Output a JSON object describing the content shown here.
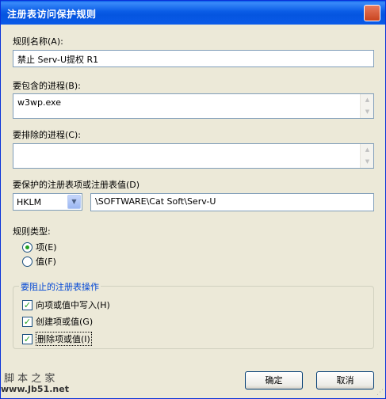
{
  "window": {
    "title": "注册表访问保护规则",
    "close_glyph": "✕"
  },
  "form": {
    "rule_name_label": "规则名称(A):",
    "rule_name_value": "禁止 Serv-U提权 R1",
    "include_label": "要包含的进程(B):",
    "include_value": "w3wp.exe",
    "exclude_label": "要排除的进程(C):",
    "exclude_value": "",
    "regkey_label": "要保护的注册表项或注册表值(D)",
    "hive_value": "HKLM",
    "key_path_value": "\\SOFTWARE\\Cat Soft\\Serv-U",
    "rule_type_label": "规则类型:",
    "rule_type_options": [
      {
        "label": "项(E)",
        "checked": true
      },
      {
        "label": "值(F)",
        "checked": false
      }
    ]
  },
  "block_group": {
    "title": "要阻止的注册表操作",
    "options": [
      {
        "label": "向项或值中写入(H)",
        "checked": true
      },
      {
        "label": "创建项或值(G)",
        "checked": true
      },
      {
        "label": "删除项或值(I)",
        "checked": true
      }
    ]
  },
  "buttons": {
    "ok": "确定",
    "cancel": "取消"
  },
  "icons": {
    "scroll_up": "▲",
    "scroll_down": "▼",
    "dropdown": "▼",
    "check": "✓",
    "grip": "⋰"
  },
  "watermark": {
    "line1": "脚 本 之 家",
    "line2": "www.Jb51.net"
  }
}
